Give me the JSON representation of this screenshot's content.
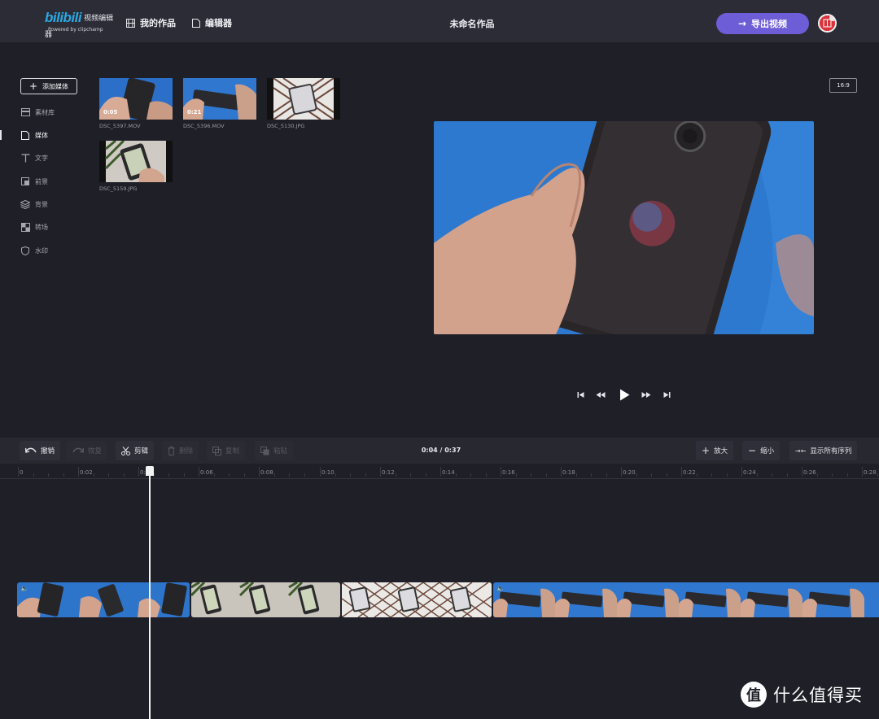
{
  "header": {
    "brand_logo": "bilibili",
    "brand_suffix": "视频编辑器",
    "brand_powered": "Powered by clipchamp",
    "nav_projects": "我的作品",
    "nav_editor": "编辑器",
    "doc_title": "未命名作品",
    "export_label": "导出视频"
  },
  "sidebar": {
    "add_media": "添加媒体",
    "items": [
      {
        "label": "素材库",
        "icon": "library-icon"
      },
      {
        "label": "媒体",
        "icon": "file-icon",
        "active": true
      },
      {
        "label": "文字",
        "icon": "text-icon"
      },
      {
        "label": "前景",
        "icon": "foreground-icon"
      },
      {
        "label": "背景",
        "icon": "layers-icon"
      },
      {
        "label": "转场",
        "icon": "transition-icon"
      },
      {
        "label": "水印",
        "icon": "shield-icon"
      }
    ]
  },
  "media": [
    {
      "name": "DSC_5397.MOV",
      "duration": "0:05"
    },
    {
      "name": "DSC_5396.MOV",
      "duration": "0:21"
    },
    {
      "name": "DSC_5130.JPG",
      "duration": ""
    },
    {
      "name": "DSC_5159.JPG",
      "duration": ""
    }
  ],
  "preview": {
    "aspect_ratio": "16:9"
  },
  "toolbar": {
    "undo": "撤销",
    "redo": "恢复",
    "cut": "剪辑",
    "delete": "删除",
    "copy": "复制",
    "paste": "粘贴",
    "time": "0:04 / 0:37",
    "zoom_in": "放大",
    "zoom_out": "缩小",
    "fit_all": "显示所有序列"
  },
  "ruler": {
    "labels": [
      "0",
      "0:02",
      "0:04",
      "0:06",
      "0:08",
      "0:10",
      "0:12",
      "0:14",
      "0:16",
      "0:18",
      "0:20",
      "0:22",
      "0:24",
      "0:26",
      "0:28"
    ]
  },
  "watermark": {
    "glyph": "值",
    "text": "什么值得买"
  },
  "colors": {
    "accent": "#6d5dd6",
    "background": "#1f1f27",
    "header": "#2c2c36",
    "brand": "#29a9e3"
  }
}
